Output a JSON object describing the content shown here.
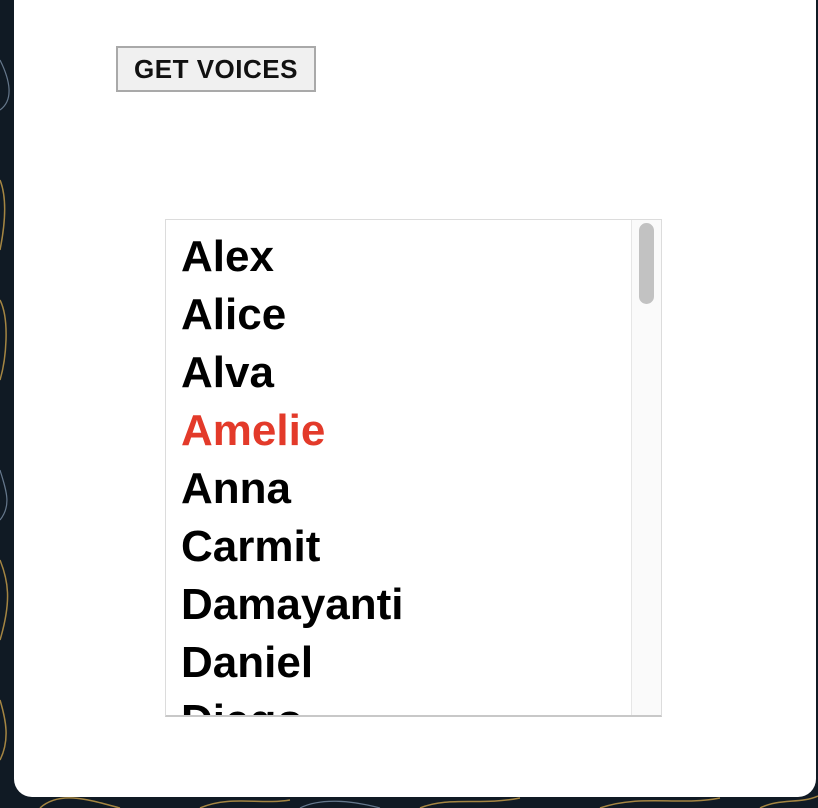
{
  "button": {
    "label": "GET VOICES"
  },
  "voices": {
    "items": [
      "Alex",
      "Alice",
      "Alva",
      "Amelie",
      "Anna",
      "Carmit",
      "Damayanti",
      "Daniel",
      "Diego"
    ],
    "selected": "Amelie",
    "selected_color": "#e33a2a",
    "text_color": "#000000"
  },
  "colors": {
    "card": "#ffffff",
    "background": "#101a24",
    "background_lines": "#c9a04a"
  }
}
